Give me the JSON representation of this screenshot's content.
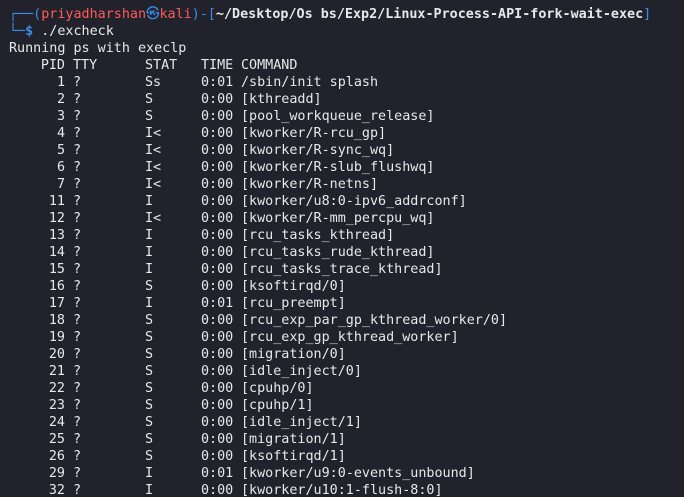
{
  "prompt": {
    "corner_top": "┌──(",
    "user": "priyadharshan",
    "at_symbol": "㉿",
    "host": "kali",
    "close_paren": ")",
    "dash_bracket": "-[",
    "path": "~/Desktop/Os bs/Exp2/Linux-Process-API-fork-wait-exec",
    "close_bracket": "]",
    "corner_bottom": "└─",
    "dollar": "$",
    "command": " ./excheck"
  },
  "output_header": "Running ps with execlp",
  "columns": {
    "pid": "PID",
    "tty": "TTY",
    "stat": "STAT",
    "time": "TIME",
    "command": "COMMAND"
  },
  "rows": [
    {
      "pid": "1",
      "tty": "?",
      "stat": "Ss",
      "time": "0:01",
      "command": "/sbin/init splash"
    },
    {
      "pid": "2",
      "tty": "?",
      "stat": "S",
      "time": "0:00",
      "command": "[kthreadd]"
    },
    {
      "pid": "3",
      "tty": "?",
      "stat": "S",
      "time": "0:00",
      "command": "[pool_workqueue_release]"
    },
    {
      "pid": "4",
      "tty": "?",
      "stat": "I<",
      "time": "0:00",
      "command": "[kworker/R-rcu_gp]"
    },
    {
      "pid": "5",
      "tty": "?",
      "stat": "I<",
      "time": "0:00",
      "command": "[kworker/R-sync_wq]"
    },
    {
      "pid": "6",
      "tty": "?",
      "stat": "I<",
      "time": "0:00",
      "command": "[kworker/R-slub_flushwq]"
    },
    {
      "pid": "7",
      "tty": "?",
      "stat": "I<",
      "time": "0:00",
      "command": "[kworker/R-netns]"
    },
    {
      "pid": "11",
      "tty": "?",
      "stat": "I",
      "time": "0:00",
      "command": "[kworker/u8:0-ipv6_addrconf]"
    },
    {
      "pid": "12",
      "tty": "?",
      "stat": "I<",
      "time": "0:00",
      "command": "[kworker/R-mm_percpu_wq]"
    },
    {
      "pid": "13",
      "tty": "?",
      "stat": "I",
      "time": "0:00",
      "command": "[rcu_tasks_kthread]"
    },
    {
      "pid": "14",
      "tty": "?",
      "stat": "I",
      "time": "0:00",
      "command": "[rcu_tasks_rude_kthread]"
    },
    {
      "pid": "15",
      "tty": "?",
      "stat": "I",
      "time": "0:00",
      "command": "[rcu_tasks_trace_kthread]"
    },
    {
      "pid": "16",
      "tty": "?",
      "stat": "S",
      "time": "0:00",
      "command": "[ksoftirqd/0]"
    },
    {
      "pid": "17",
      "tty": "?",
      "stat": "I",
      "time": "0:01",
      "command": "[rcu_preempt]"
    },
    {
      "pid": "18",
      "tty": "?",
      "stat": "S",
      "time": "0:00",
      "command": "[rcu_exp_par_gp_kthread_worker/0]"
    },
    {
      "pid": "19",
      "tty": "?",
      "stat": "S",
      "time": "0:00",
      "command": "[rcu_exp_gp_kthread_worker]"
    },
    {
      "pid": "20",
      "tty": "?",
      "stat": "S",
      "time": "0:00",
      "command": "[migration/0]"
    },
    {
      "pid": "21",
      "tty": "?",
      "stat": "S",
      "time": "0:00",
      "command": "[idle_inject/0]"
    },
    {
      "pid": "22",
      "tty": "?",
      "stat": "S",
      "time": "0:00",
      "command": "[cpuhp/0]"
    },
    {
      "pid": "23",
      "tty": "?",
      "stat": "S",
      "time": "0:00",
      "command": "[cpuhp/1]"
    },
    {
      "pid": "24",
      "tty": "?",
      "stat": "S",
      "time": "0:00",
      "command": "[idle_inject/1]"
    },
    {
      "pid": "25",
      "tty": "?",
      "stat": "S",
      "time": "0:00",
      "command": "[migration/1]"
    },
    {
      "pid": "26",
      "tty": "?",
      "stat": "S",
      "time": "0:00",
      "command": "[ksoftirqd/1]"
    },
    {
      "pid": "29",
      "tty": "?",
      "stat": "I",
      "time": "0:01",
      "command": "[kworker/u9:0-events_unbound]"
    },
    {
      "pid": "32",
      "tty": "?",
      "stat": "I",
      "time": "0:00",
      "command": "[kworker/u10:1-flush-8:0]"
    }
  ],
  "colors": {
    "background": "#21222c",
    "text": "#e8e8ea",
    "prompt_frame": "#3b8eea",
    "user_host": "#ff5c57",
    "path": "#e8e8ea",
    "command": "#5af78e"
  }
}
